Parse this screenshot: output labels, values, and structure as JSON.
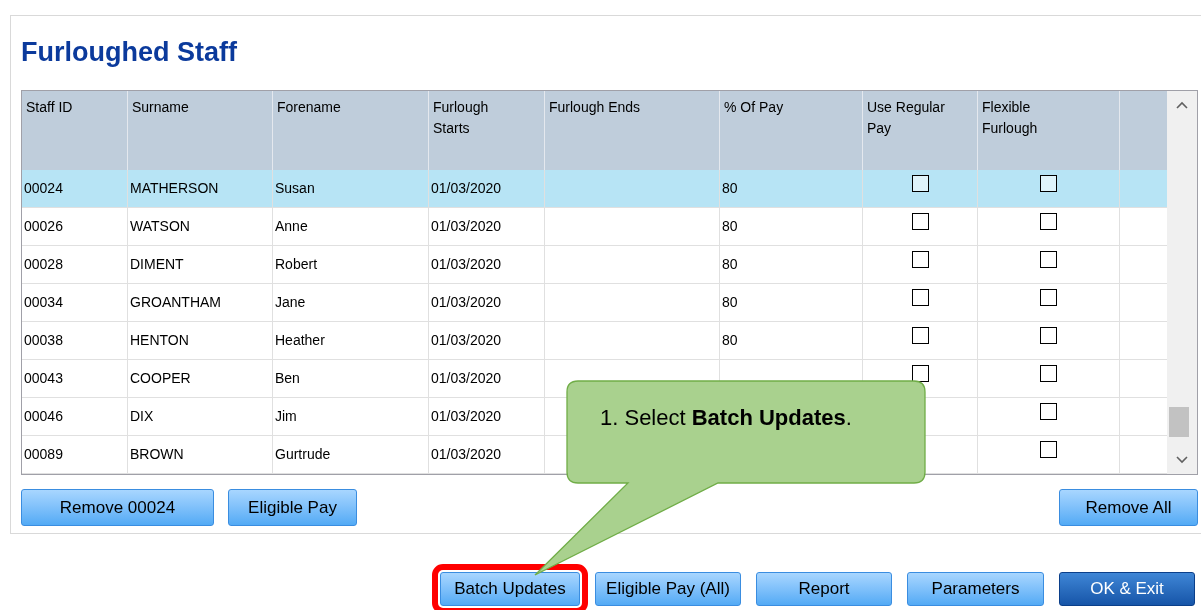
{
  "title": "Furloughed Staff",
  "table": {
    "columns": [
      "Staff ID",
      "Surname",
      "Forename",
      "Furlough Starts",
      "Furlough Ends",
      "% Of Pay",
      "Use Regular Pay",
      "Flexible Furlough"
    ],
    "rows": [
      {
        "selected": true,
        "staff_id": "00024",
        "surname": "MATHERSON",
        "forename": "Susan",
        "starts": "01/03/2020",
        "pay": "80",
        "regular_pay": {
          "checked": false
        },
        "flexible": {
          "checked": false
        }
      },
      {
        "selected": false,
        "staff_id": "00026",
        "surname": "WATSON",
        "forename": "Anne",
        "starts": "01/03/2020",
        "pay": "80",
        "regular_pay": {
          "checked": false
        },
        "flexible": {
          "checked": false
        }
      },
      {
        "selected": false,
        "staff_id": "00028",
        "surname": "DIMENT",
        "forename": "Robert",
        "starts": "01/03/2020",
        "pay": "80",
        "regular_pay": {
          "checked": false
        },
        "flexible": {
          "checked": false
        }
      },
      {
        "selected": false,
        "staff_id": "00034",
        "surname": "GROANTHAM",
        "forename": "Jane",
        "starts": "01/03/2020",
        "pay": "80",
        "regular_pay": {
          "checked": false
        },
        "flexible": {
          "checked": false
        }
      },
      {
        "selected": false,
        "staff_id": "00038",
        "surname": "HENTON",
        "forename": "Heather",
        "starts": "01/03/2020",
        "pay": "80",
        "regular_pay": {
          "checked": false
        },
        "flexible": {
          "checked": false
        }
      },
      {
        "selected": false,
        "staff_id": "00043",
        "surname": "COOPER",
        "forename": "Ben",
        "starts": "01/03/2020",
        "regular_pay": {
          "checked": false
        },
        "flexible": {
          "checked": false
        }
      },
      {
        "selected": false,
        "staff_id": "00046",
        "surname": "DIX",
        "forename": "Jim",
        "starts": "01/03/2020",
        "flexible": {
          "checked": false
        }
      },
      {
        "selected": false,
        "staff_id": "00089",
        "surname": "BROWN",
        "forename": "Gurtrude",
        "starts": "01/03/2020",
        "flexible": {
          "checked": false
        }
      }
    ]
  },
  "panel_buttons": [
    "Remove 00024",
    "Eligible Pay"
  ],
  "remove_all_button": "Remove All",
  "footer_buttons": [
    {
      "label": "Batch Updates",
      "highlighted": true,
      "kind": "normal"
    },
    {
      "label": "Eligible Pay (All)",
      "highlighted": false,
      "kind": "normal"
    },
    {
      "label": "Report",
      "highlighted": false,
      "kind": "normal"
    },
    {
      "label": "Parameters",
      "highlighted": false,
      "kind": "normal"
    },
    {
      "label": "OK & Exit",
      "highlighted": false,
      "kind": "default"
    }
  ],
  "callout": {
    "text": "1. Select **Batch Updates**."
  }
}
